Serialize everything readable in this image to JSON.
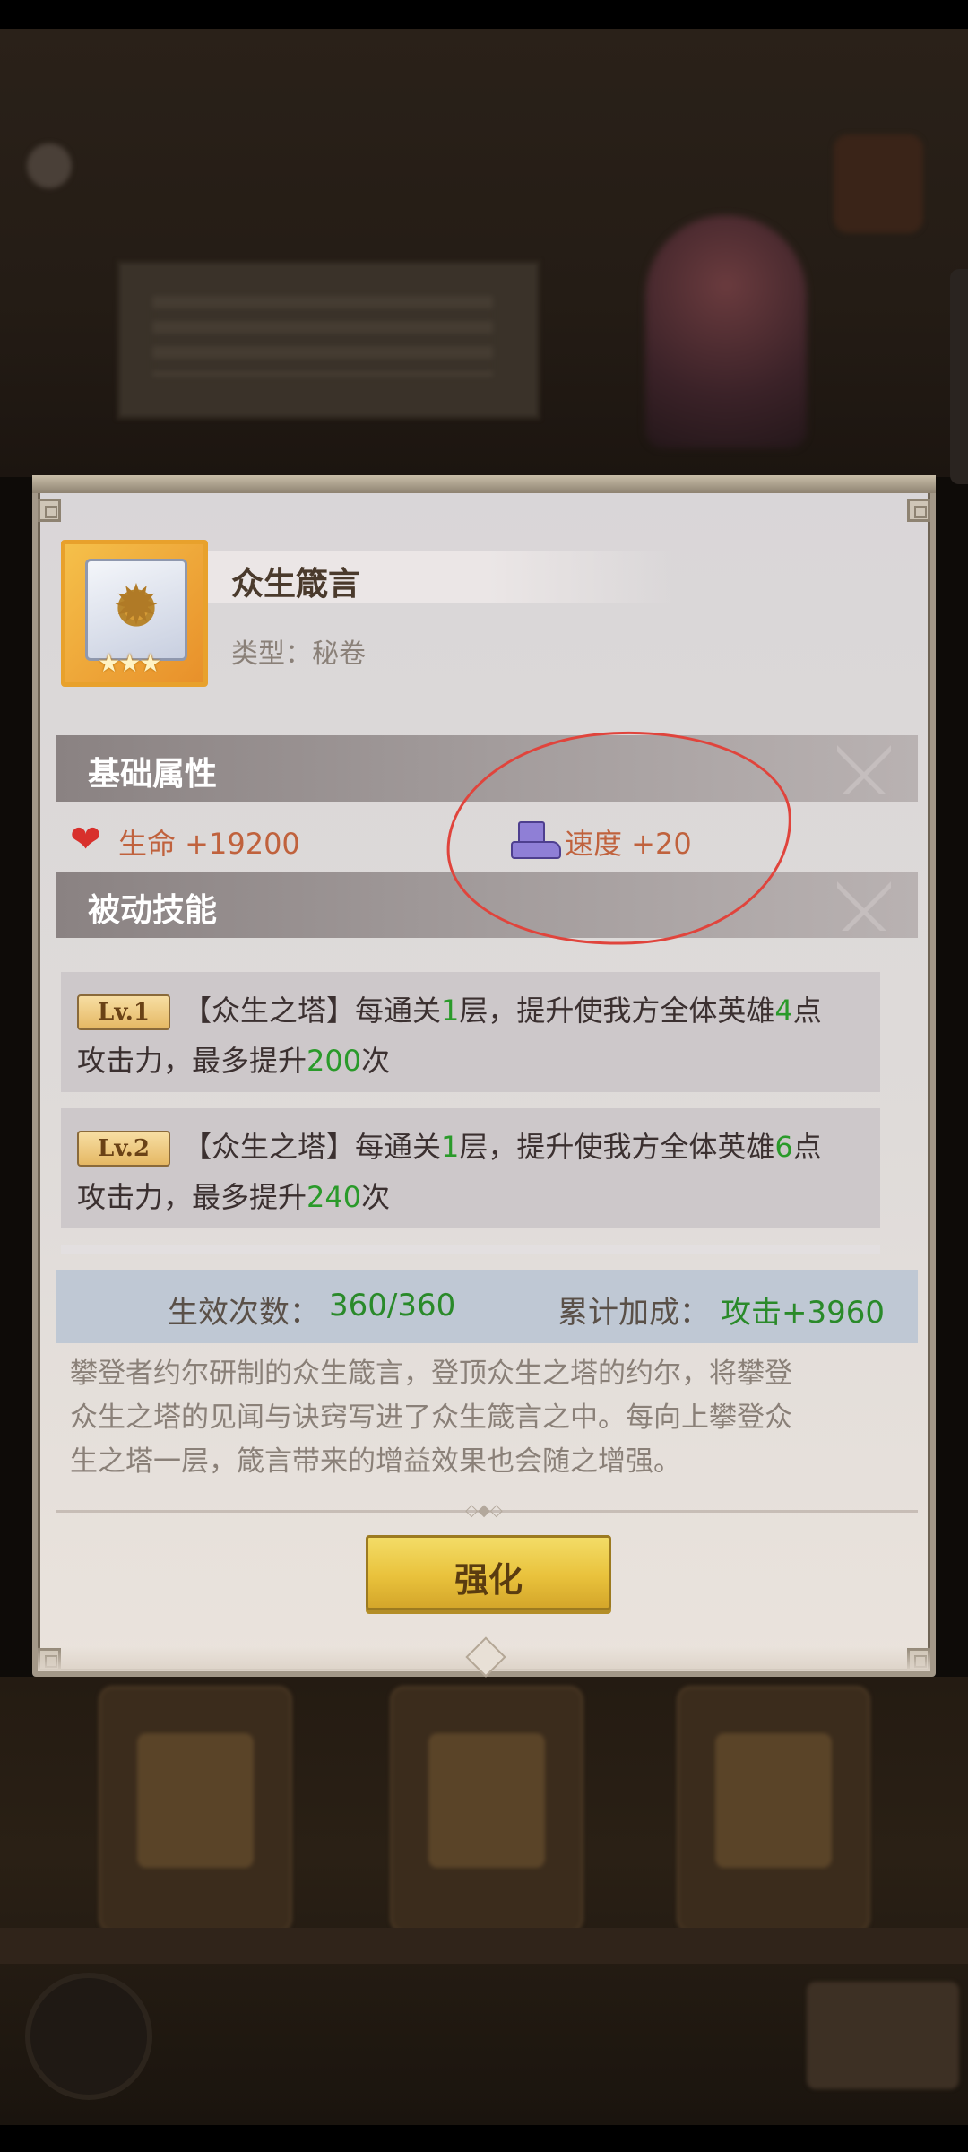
{
  "item": {
    "name": "众生箴言",
    "type_label": "类型：秘卷",
    "stars": "★★★"
  },
  "sections": {
    "base_title": "基础属性",
    "passive_title": "被动技能"
  },
  "stats": {
    "hp": "生命 +19200",
    "speed": "速度 +20"
  },
  "skills": [
    {
      "badge": "Lv.1",
      "line1_a": "【众生之塔】每通关",
      "line1_b": "1",
      "line1_c": "层，提升使我方全体英雄",
      "line1_d": "4",
      "line1_e": "点",
      "line2_a": "攻击力，最多提升",
      "line2_b": "200",
      "line2_c": "次"
    },
    {
      "badge": "Lv.2",
      "line1_a": "【众生之塔】每通关",
      "line1_b": "1",
      "line1_c": "层，提升使我方全体英雄",
      "line1_d": "6",
      "line1_e": "点",
      "line2_a": "攻击力，最多提升",
      "line2_b": "240",
      "line2_c": "次"
    }
  ],
  "effect": {
    "count_label": "生效次数：",
    "count_value": "360/360",
    "bonus_label": "累计加成：",
    "bonus_value": "攻击+3960"
  },
  "description": {
    "line1": "攀登者约尔研制的众生箴言，登顶众生之塔的约尔，将攀登",
    "line2": "众生之塔的见闻与诀窍写进了众生箴言之中。每向上攀登众",
    "line3": "生之塔一层，箴言带来的增益效果也会随之增强。"
  },
  "button": {
    "label": "强化"
  },
  "colors": {
    "accent_green": "#2a9a2a",
    "stat_text": "#c0623d",
    "button_yellow": "#e9c23c",
    "annotation_red": "#e0443c"
  },
  "icons": [
    "heart-icon",
    "boot-icon",
    "sun-scroll-icon",
    "star-icon",
    "diamond-ornament-icon"
  ]
}
